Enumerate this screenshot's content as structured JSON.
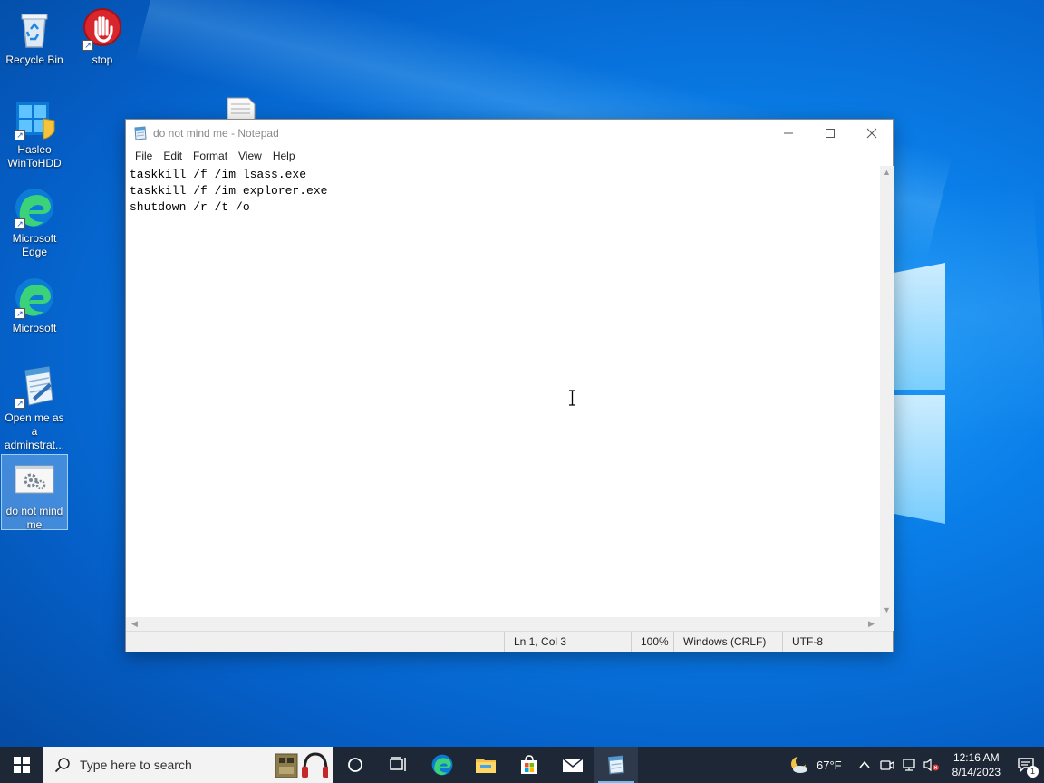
{
  "desktop": {
    "icons": [
      {
        "label": "Recycle Bin"
      },
      {
        "label": "stop"
      },
      {
        "label": "Hasleo WinToHDD"
      },
      {
        "label": "Microsoft Edge"
      },
      {
        "label": "Microsoft"
      },
      {
        "label": "Open me as a adminstrat..."
      },
      {
        "label": "do not mind me"
      }
    ]
  },
  "notepad": {
    "title": "do not mind me - Notepad",
    "menu": [
      "File",
      "Edit",
      "Format",
      "View",
      "Help"
    ],
    "lines": [
      "taskkill /f /im lsass.exe",
      "taskkill /f /im explorer.exe",
      "shutdown /r /t /o"
    ],
    "status": {
      "position": "Ln 1, Col 3",
      "zoom": "100%",
      "line_ending": "Windows (CRLF)",
      "encoding": "UTF-8"
    }
  },
  "taskbar": {
    "search_placeholder": "Type here to search",
    "weather": "67°F",
    "time": "12:16 AM",
    "date": "8/14/2023",
    "notification_count": "1"
  },
  "colors": {
    "desktop_accent": "#0a7ee8",
    "taskbar": "#1d2735",
    "active_indicator": "#76b9ed"
  }
}
